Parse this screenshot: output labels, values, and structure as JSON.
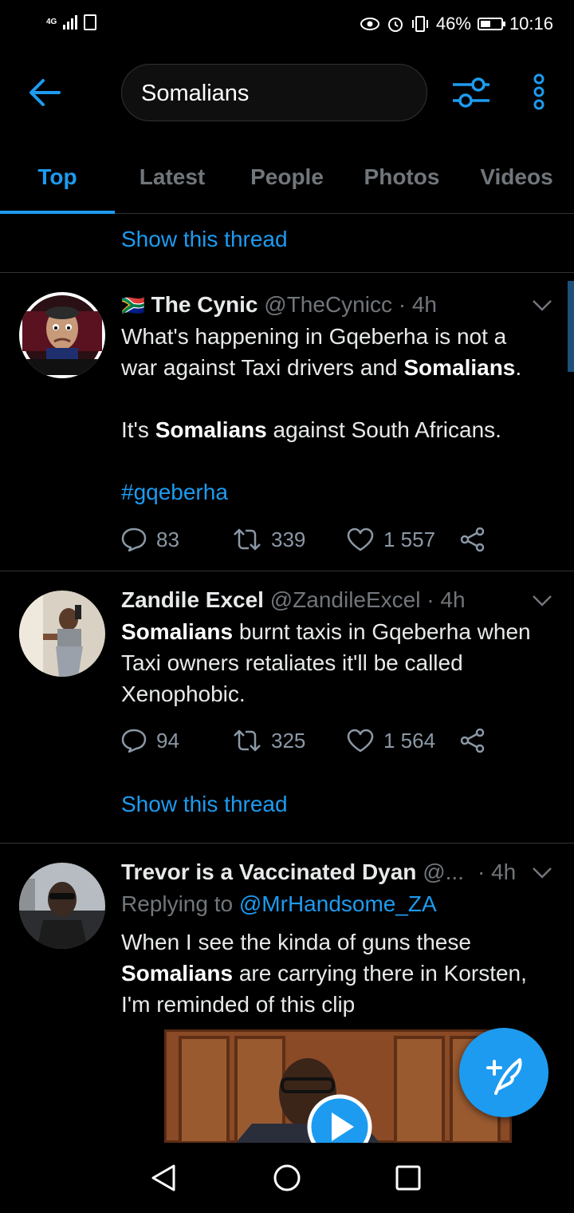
{
  "status": {
    "network": "4G",
    "battery": "46%",
    "time": "10:16"
  },
  "search": {
    "query": "Somalians"
  },
  "tabs": [
    "Top",
    "Latest",
    "People",
    "Photos",
    "Videos"
  ],
  "show_thread": "Show this thread",
  "tweets": [
    {
      "flag": "🇿🇦",
      "name": "The Cynic",
      "handle": "@TheCynicc",
      "time": "· 4h",
      "avatar_caption": "MUTATE HELL LA",
      "lines": [
        "What's happening in Gqeberha is not a",
        "war against Taxi drivers and",
        "Somalians",
        ".",
        "It's",
        "Somalians",
        "against South Africans."
      ],
      "hashtag": "#gqeberha",
      "replies": "83",
      "retweets": "339",
      "likes": "1 557"
    },
    {
      "name": "Zandile Excel",
      "handle": "@ZandileExcel",
      "time": "· 4h",
      "lines": [
        "Somalians",
        "burnt taxis in Gqeberha when",
        "Taxi owners retaliates it'll be called",
        "Xenophobic."
      ],
      "replies": "94",
      "retweets": "325",
      "likes": "1 564"
    },
    {
      "name": "Trevor is a Vaccinated Dyan",
      "handle": "@...",
      "time": "· 4h",
      "replying_label": "Replying to",
      "replying_to": "@MrHandsome_ZA",
      "lines": [
        "When I see the kinda of guns these",
        "Somalians",
        "are carrying there in Korsten,",
        "I'm reminded of this clip"
      ]
    }
  ]
}
